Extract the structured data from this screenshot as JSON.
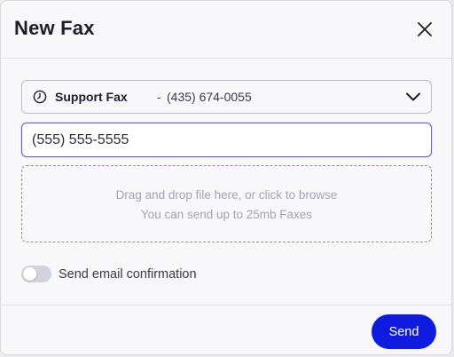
{
  "dialog": {
    "title": "New Fax"
  },
  "fax_line": {
    "name": "Support Fax",
    "separator": "-",
    "number": "(435) 674-0055"
  },
  "recipient": {
    "value": "(555) 555-5555"
  },
  "dropzone": {
    "line1": "Drag and drop file here, or click to browse",
    "line2": "You can send up to 25mb Faxes"
  },
  "email_confirmation": {
    "label": "Send email confirmation",
    "enabled": false
  },
  "footer": {
    "send_label": "Send"
  },
  "colors": {
    "accent": "#0f1ce0",
    "focus_border": "#5b63d9"
  },
  "icons": {
    "close": "close-icon",
    "clock": "clock-icon",
    "chevron": "chevron-down-icon"
  }
}
